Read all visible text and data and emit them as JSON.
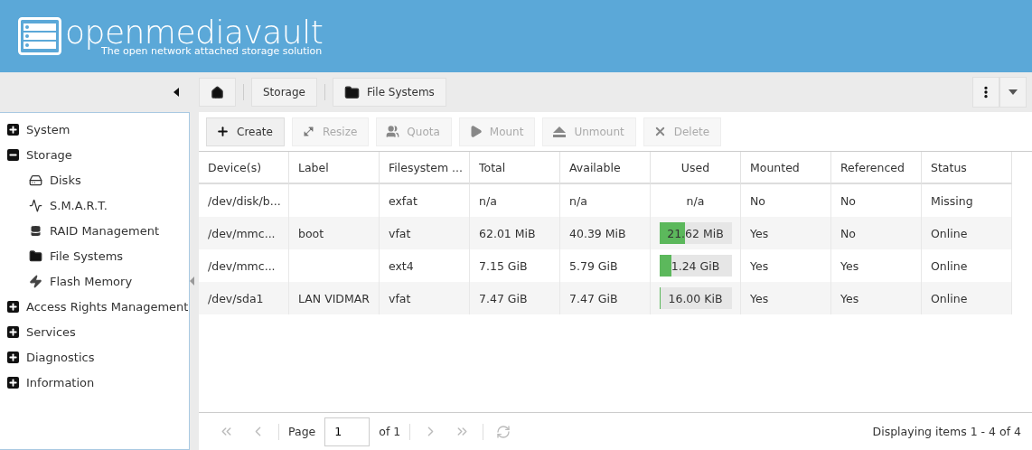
{
  "header": {
    "brand": "openmediavault",
    "tagline": "The open network attached storage solution"
  },
  "breadcrumb": [
    {
      "kind": "home"
    },
    {
      "kind": "text",
      "label": "Storage"
    },
    {
      "kind": "folder",
      "label": "File Systems"
    }
  ],
  "sidebar": {
    "items": [
      {
        "label": "System",
        "expanded": false
      },
      {
        "label": "Storage",
        "expanded": true,
        "children": [
          {
            "label": "Disks"
          },
          {
            "label": "S.M.A.R.T."
          },
          {
            "label": "RAID Management"
          },
          {
            "label": "File Systems"
          },
          {
            "label": "Flash Memory"
          }
        ]
      },
      {
        "label": "Access Rights Management",
        "expanded": false
      },
      {
        "label": "Services",
        "expanded": false
      },
      {
        "label": "Diagnostics",
        "expanded": false
      },
      {
        "label": "Information",
        "expanded": false
      }
    ]
  },
  "actions": [
    {
      "label": "Create",
      "disabled": false
    },
    {
      "label": "Resize",
      "disabled": true
    },
    {
      "label": "Quota",
      "disabled": true
    },
    {
      "label": "Mount",
      "disabled": true
    },
    {
      "label": "Unmount",
      "disabled": true
    },
    {
      "label": "Delete",
      "disabled": true
    }
  ],
  "table": {
    "columns": [
      "Device(s)",
      "Label",
      "Filesystem ...",
      "Total",
      "Available",
      "Used",
      "Mounted",
      "Referenced",
      "Status"
    ],
    "rows": [
      {
        "device": "/dev/disk/b...",
        "label": "",
        "filesystem": "exfat",
        "total": "n/a",
        "available": "n/a",
        "used": {
          "kind": "text",
          "text": "n/a"
        },
        "mounted": "No",
        "referenced": "No",
        "status": "Missing"
      },
      {
        "device": "/dev/mmc...",
        "label": "boot",
        "filesystem": "vfat",
        "total": "62.01 MiB",
        "available": "40.39 MiB",
        "used": {
          "kind": "bar",
          "text": "21.62 MiB",
          "level": 0.35
        },
        "mounted": "Yes",
        "referenced": "No",
        "status": "Online"
      },
      {
        "device": "/dev/mmc...",
        "label": "",
        "filesystem": "ext4",
        "total": "7.15 GiB",
        "available": "5.79 GiB",
        "used": {
          "kind": "bar",
          "text": "1.24 GiB",
          "level": 0.17
        },
        "mounted": "Yes",
        "referenced": "Yes",
        "status": "Online"
      },
      {
        "device": "/dev/sda1",
        "label": "LAN VIDMAR",
        "filesystem": "vfat",
        "total": "7.47 GiB",
        "available": "7.47 GiB",
        "used": {
          "kind": "bar",
          "text": "16.00 KiB",
          "level": 0.01
        },
        "mounted": "Yes",
        "referenced": "Yes",
        "status": "Online"
      }
    ]
  },
  "pager": {
    "page_label": "Page",
    "page": "1",
    "of": "of 1",
    "summary": "Displaying items 1 - 4 of 4"
  }
}
